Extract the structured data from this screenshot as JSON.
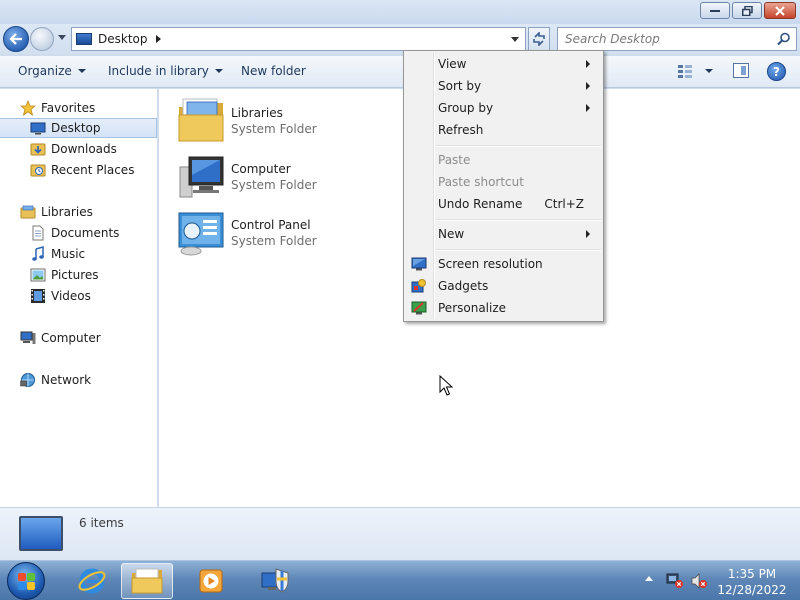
{
  "address": {
    "crumb": "Desktop"
  },
  "search": {
    "placeholder": "Search Desktop"
  },
  "toolbar": {
    "organize": "Organize",
    "include_in_library": "Include in library",
    "new_folder": "New folder",
    "help": "?"
  },
  "nav": {
    "favorites": {
      "label": "Favorites",
      "icon": "star-icon"
    },
    "favorites_items": [
      {
        "label": "Desktop",
        "icon": "desktop-icon",
        "selected": true
      },
      {
        "label": "Downloads",
        "icon": "downloads-folder-icon"
      },
      {
        "label": "Recent Places",
        "icon": "recent-places-icon"
      }
    ],
    "libraries": {
      "label": "Libraries",
      "icon": "libraries-icon"
    },
    "libraries_items": [
      {
        "label": "Documents",
        "icon": "document-icon"
      },
      {
        "label": "Music",
        "icon": "music-note-icon"
      },
      {
        "label": "Pictures",
        "icon": "pictures-icon"
      },
      {
        "label": "Videos",
        "icon": "film-icon"
      }
    ],
    "computer": {
      "label": "Computer",
      "icon": "computer-icon"
    },
    "network": {
      "label": "Network",
      "icon": "network-icon"
    }
  },
  "content": {
    "items": [
      {
        "name": "Libraries",
        "type": "System Folder",
        "icon": "libraries-folder-icon"
      },
      {
        "name": "Computer",
        "type": "System Folder",
        "icon": "computer-icon"
      },
      {
        "name": "Control Panel",
        "type": "System Folder",
        "icon": "control-panel-icon"
      }
    ]
  },
  "details": {
    "count": "6 items"
  },
  "context_menu": {
    "items": [
      {
        "label": "View",
        "submenu": true
      },
      {
        "label": "Sort by",
        "submenu": true
      },
      {
        "label": "Group by",
        "submenu": true
      },
      {
        "label": "Refresh"
      },
      {
        "label": "Paste",
        "disabled": true
      },
      {
        "label": "Paste shortcut",
        "disabled": true
      },
      {
        "label": "Undo Rename",
        "shortcut": "Ctrl+Z"
      },
      {
        "label": "New",
        "submenu": true
      },
      {
        "label": "Screen resolution",
        "icon": "screen-resolution-icon"
      },
      {
        "label": "Gadgets",
        "icon": "gadgets-icon"
      },
      {
        "label": "Personalize",
        "icon": "personalize-icon"
      }
    ]
  },
  "taskbar": {
    "time": "1:35 PM",
    "date": "12/28/2022",
    "pinned": [
      "internet-explorer-icon",
      "windows-explorer-icon",
      "media-player-icon",
      "action-center-icon"
    ]
  },
  "colors": {
    "accent": "#2a62b6",
    "selection": "#d4e3f6",
    "taskbar": "#5f87b7"
  }
}
